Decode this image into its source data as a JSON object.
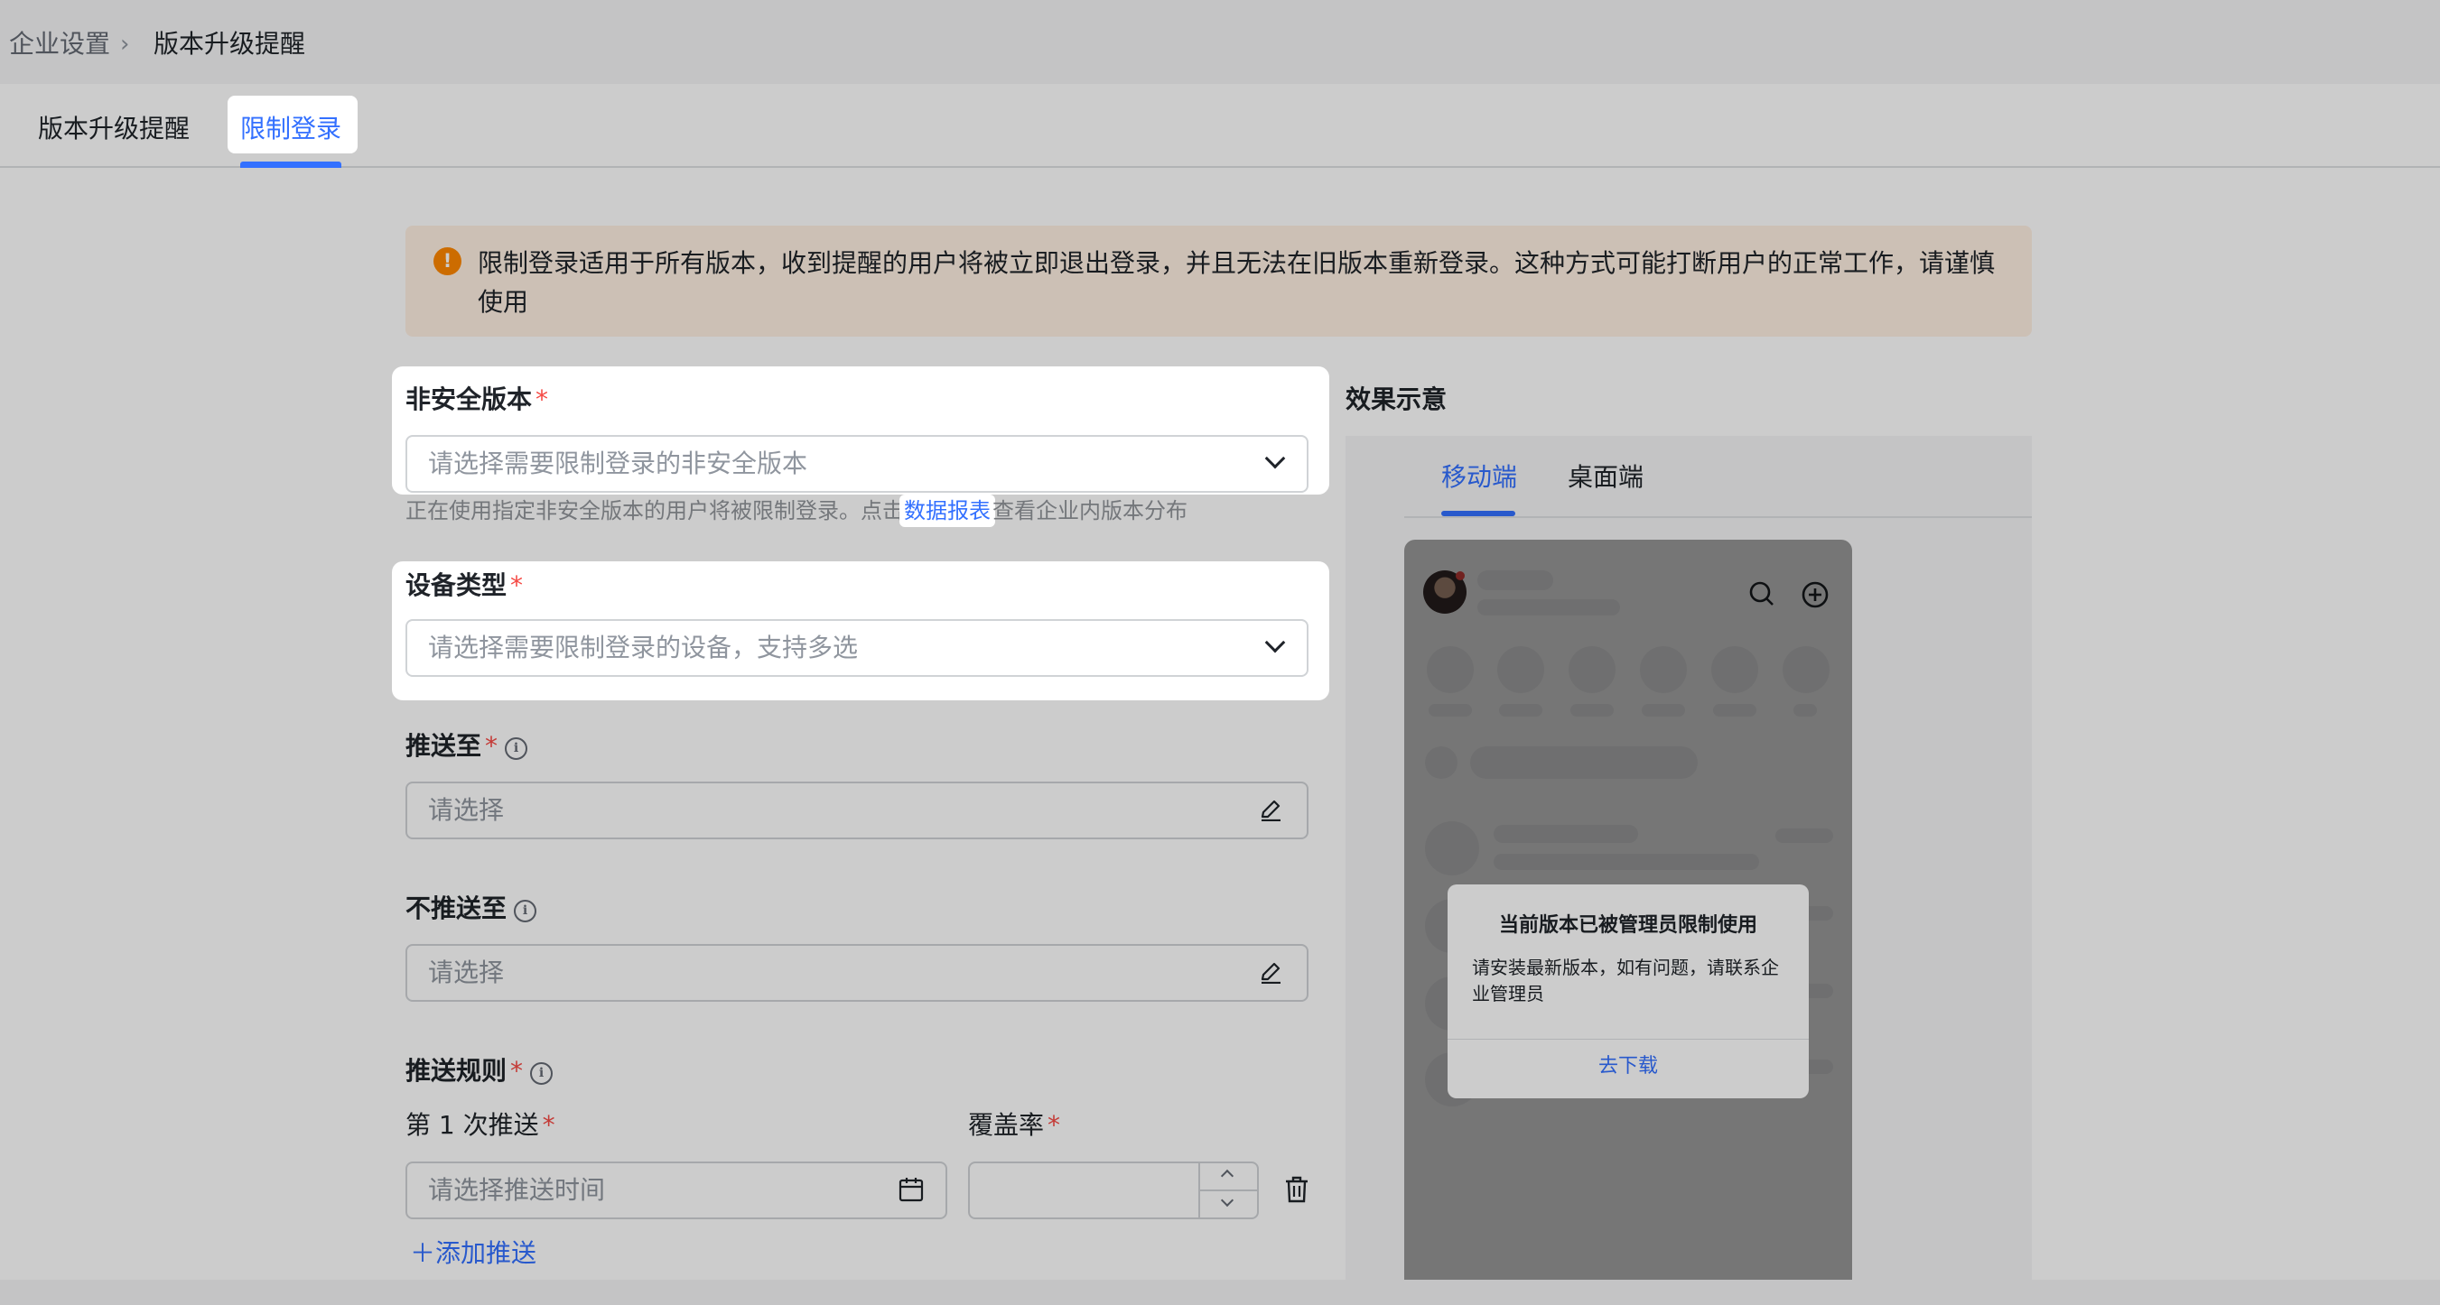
{
  "breadcrumb": {
    "parent": "企业设置",
    "separator": "›",
    "current": "版本升级提醒"
  },
  "tabs": [
    {
      "label": "版本升级提醒"
    },
    {
      "label": "限制登录"
    }
  ],
  "alert": {
    "icon": "warning-icon",
    "text": "限制登录适用于所有版本，收到提醒的用户将被立即退出登录，并且无法在旧版本重新登录。这种方式可能打断用户的正常工作，请谨慎使用"
  },
  "form": {
    "insecure_version": {
      "label": "非安全版本",
      "required": "*",
      "placeholder": "请选择需要限制登录的非安全版本",
      "hint_prefix": "正在使用指定非安全版本的用户将被限制登录。点击",
      "hint_link": "数据报表",
      "hint_suffix": "查看企业内版本分布"
    },
    "device_type": {
      "label": "设备类型",
      "required": "*",
      "placeholder": "请选择需要限制登录的设备，支持多选"
    },
    "push_to": {
      "label": "推送至",
      "required": "*",
      "placeholder": "请选择"
    },
    "not_push_to": {
      "label": "不推送至",
      "placeholder": "请选择"
    },
    "push_rules": {
      "label": "推送规则",
      "required": "*",
      "first_push_label": "第 1 次推送",
      "first_push_placeholder": "请选择推送时间",
      "coverage_label": "覆盖率",
      "coverage_value": "",
      "add_push": "添加推送"
    }
  },
  "preview": {
    "title": "效果示意",
    "tabs": [
      {
        "label": "移动端"
      },
      {
        "label": "桌面端"
      }
    ],
    "dialog": {
      "title": "当前版本已被管理员限制使用",
      "body": "请安装最新版本，如有问题，请联系企业管理员",
      "button": "去下载"
    }
  },
  "colors": {
    "accent": "#3370ff",
    "required": "#f54a45",
    "warning": "#ff8800",
    "alert_bg": "#fff0e3"
  }
}
